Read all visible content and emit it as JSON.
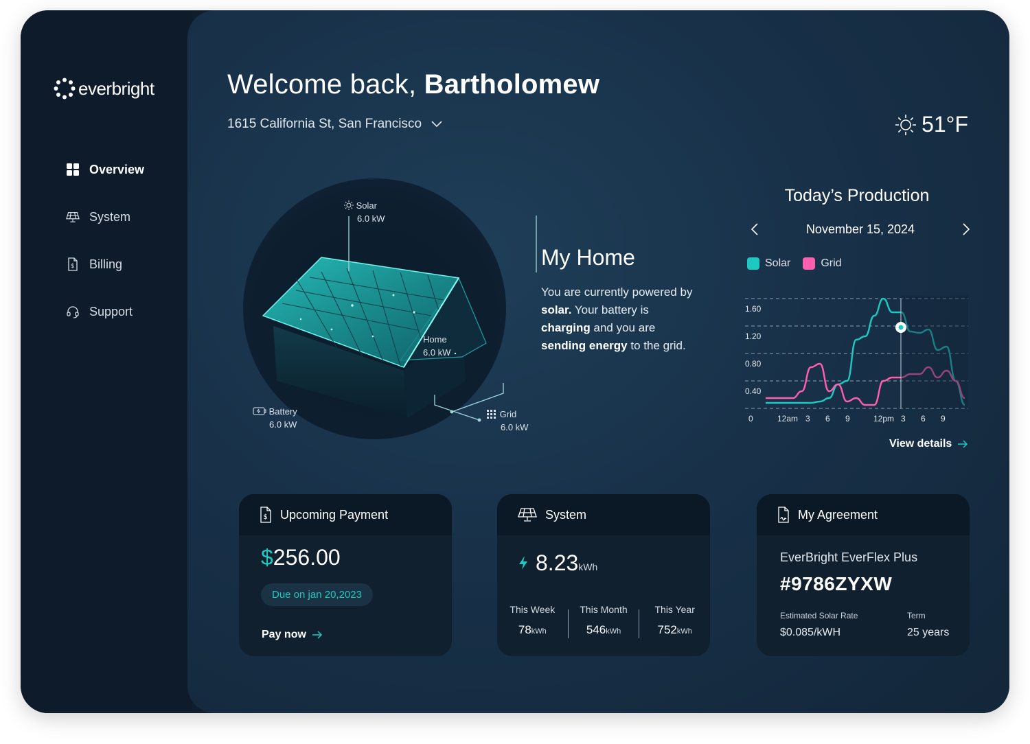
{
  "brand": {
    "name": "everbright"
  },
  "nav": {
    "items": [
      {
        "label": "Overview",
        "icon": "grid-icon",
        "active": true
      },
      {
        "label": "System",
        "icon": "solar-panel-icon"
      },
      {
        "label": "Billing",
        "icon": "bill-icon"
      },
      {
        "label": "Support",
        "icon": "headset-icon"
      }
    ]
  },
  "header": {
    "welcome_prefix": "Welcome back, ",
    "user_name": "Bartholomew",
    "address": "1615 California St, San Francisco",
    "temperature": "51°F"
  },
  "house": {
    "solar": {
      "label": "Solar",
      "value": "6.0 kW"
    },
    "home": {
      "label": "Home",
      "value": "6.0 kW"
    },
    "battery": {
      "label": "Battery",
      "value": "6.0 kW"
    },
    "grid": {
      "label": "Grid",
      "value": "6.0 kW"
    }
  },
  "my_home": {
    "title": "My Home",
    "t1": "You are currently powered by ",
    "t2": "solar.",
    "t3": " Your battery is ",
    "t4": "charging",
    "t5": " and you are ",
    "t6": "sending energy",
    "t7": " to the grid."
  },
  "production": {
    "title": "Today’s Production",
    "date": "November 15, 2024",
    "view_details": "View details"
  },
  "chart_data": {
    "type": "line",
    "x": [
      "0",
      "12am",
      "3",
      "6",
      "9",
      "12pm",
      "3",
      "6",
      "9"
    ],
    "y_ticks": [
      "1.60",
      "1.20",
      "0.80",
      "0.40"
    ],
    "ylim": [
      0,
      1.6
    ],
    "grid": true,
    "legend": "top-left",
    "series": [
      {
        "name": "Solar",
        "color": "#1ec9c1",
        "values": [
          0.08,
          0.08,
          0.08,
          0.08,
          0.08,
          0.08,
          0.1,
          0.15,
          0.35,
          0.4,
          1.0,
          1.05,
          1.35,
          1.6,
          1.4,
          1.4,
          1.12,
          1.1,
          1.15,
          0.85,
          0.9,
          0.4,
          0.05
        ]
      },
      {
        "name": "Grid",
        "color": "#ff5fae",
        "values": [
          0.15,
          0.15,
          0.15,
          0.15,
          0.25,
          0.6,
          0.65,
          0.25,
          0.35,
          0.1,
          0.15,
          0.05,
          0.05,
          0.4,
          0.45,
          0.45,
          0.5,
          0.5,
          0.6,
          0.45,
          0.55,
          0.4,
          0.15
        ]
      }
    ],
    "marker": {
      "x_label": "3",
      "series": "Solar",
      "value": 1.18
    }
  },
  "payment": {
    "title": "Upcoming Payment",
    "dollar": "$",
    "amount": "256.00",
    "due": "Due on jan 20,2023",
    "action": "Pay now"
  },
  "system": {
    "title": "System",
    "value": "8.23",
    "unit": "kWh",
    "stats": [
      {
        "label": "This Week",
        "value": "78",
        "unit": "kWh"
      },
      {
        "label": "This Month",
        "value": "546",
        "unit": "kWh"
      },
      {
        "label": "This Year",
        "value": "752",
        "unit": "kWh"
      }
    ]
  },
  "agreement": {
    "title": "My Agreement",
    "plan": "EverBright EverFlex Plus",
    "number": "#9786ZYXW",
    "rate_label": "Estimated Solar Rate",
    "rate_value": "$0.085/kWH",
    "term_label": "Term",
    "term_value": "25 years"
  },
  "colors": {
    "accent": "#1ec9c1",
    "grid": "#ff5fae",
    "panel": "#0e1b2a"
  }
}
